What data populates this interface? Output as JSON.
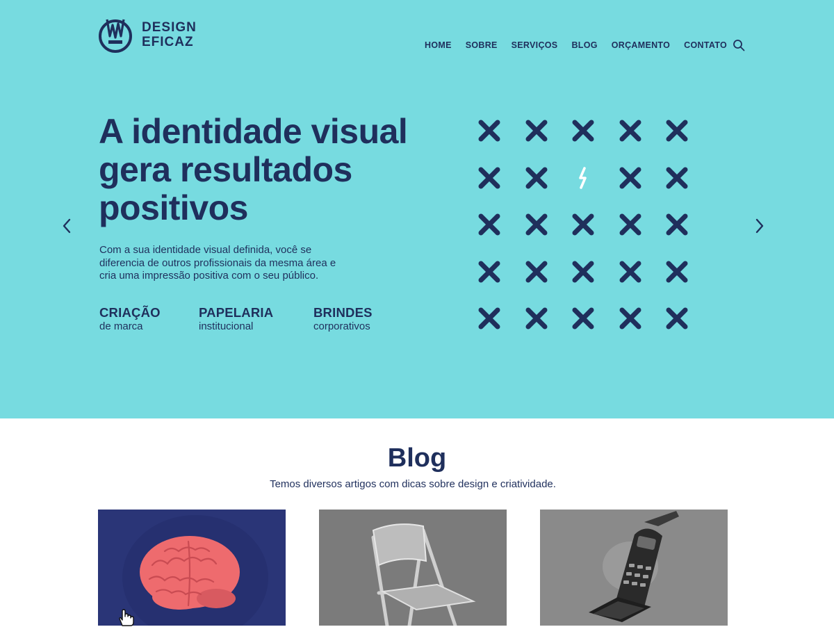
{
  "brand": {
    "line1": "DESIGN",
    "line2": "EFICAZ"
  },
  "nav": {
    "items": [
      "HOME",
      "SOBRE",
      "SERVIÇOS",
      "BLOG",
      "ORÇAMENTO",
      "CONTATO"
    ],
    "search_icon": "search-icon"
  },
  "hero": {
    "headline": "A identidade visual gera resultados positivos",
    "lead": "Com a sua identidade visual definida, você se diferencia de outros profissionais da mesma área e cria uma impressão positiva com o seu público.",
    "features": [
      {
        "title": "CRIAÇÃO",
        "sub": "de marca"
      },
      {
        "title": "PAPELARIA",
        "sub": "institucional"
      },
      {
        "title": "BRINDES",
        "sub": "corporativos"
      }
    ],
    "prev_icon": "chevron-left-icon",
    "next_icon": "chevron-right-icon",
    "grid_icons": "x-icon",
    "grid_highlight_icon": "lightning-icon"
  },
  "blog": {
    "title": "Blog",
    "subtitle": "Temos diversos artigos com dicas sobre design e criatividade.",
    "cards": [
      {
        "image": "brain-image"
      },
      {
        "image": "folding-chair-image"
      },
      {
        "image": "flip-phone-image"
      }
    ]
  },
  "colors": {
    "hero_bg": "#77dbe0",
    "navy": "#1f2f5c",
    "card1_bg": "#2a3577",
    "brain": "#ee6b6e"
  }
}
